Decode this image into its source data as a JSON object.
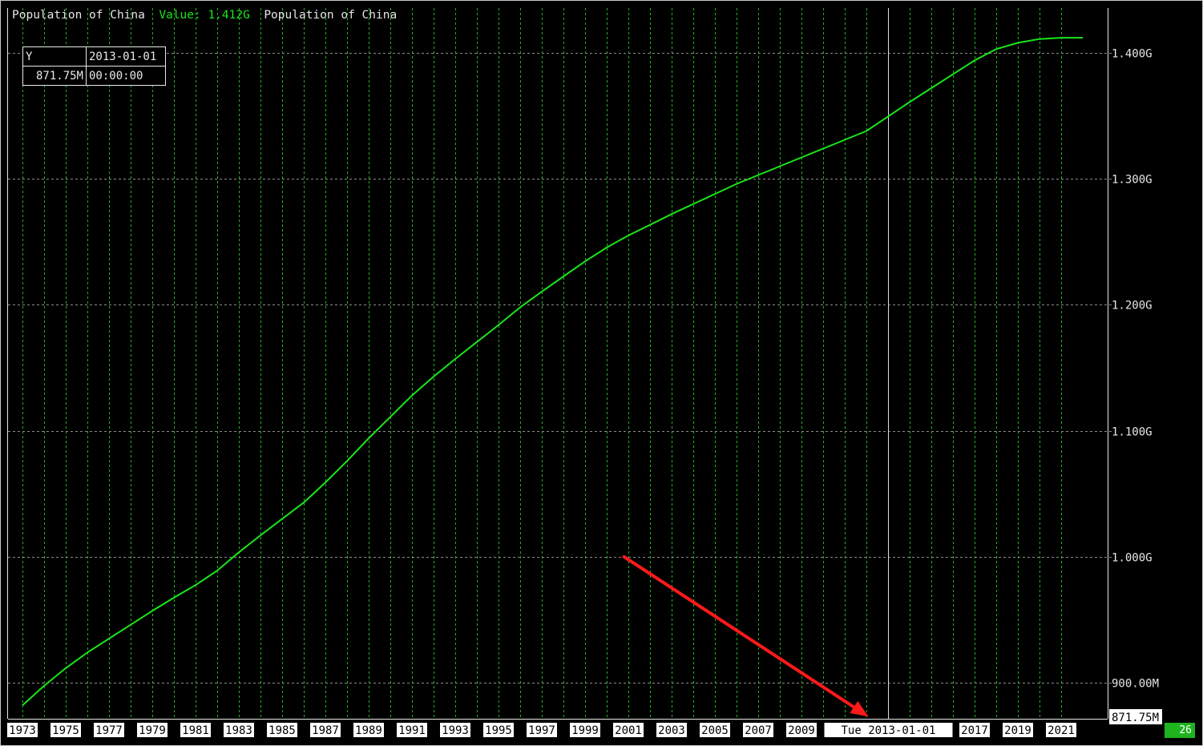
{
  "header": {
    "series_title": "Population of China",
    "value_text": "Value: 1.412G",
    "series_title_2": "Population of China"
  },
  "cursor_box": {
    "col1_header": "Y",
    "col2_header": "2013-01-01",
    "value": "871.75M",
    "time": "00:00:00"
  },
  "cursor": {
    "date_label": "Tue 2013-01-01",
    "year": 2013,
    "y_readout": "871.75M"
  },
  "status": {
    "badge": "26"
  },
  "annotation": {
    "arrow_color": "#ff1a1a",
    "arrow_from": {
      "year": 2000.8,
      "value": 1000000000
    },
    "arrow_to": {
      "year": 2012.1,
      "value": 871750000
    }
  },
  "colors": {
    "background": "#000000",
    "line": "#19e619",
    "grid_vertical": "#1fb31f",
    "grid_horizontal": "#8c8c8c",
    "cursor_line": "#e0e0e0",
    "badge": "#1fb31f"
  },
  "chart_data": {
    "type": "line",
    "title": "Population of China",
    "xlabel": "",
    "ylabel": "",
    "xlim": [
      1972,
      2023
    ],
    "ylim": [
      871750000,
      1435000000
    ],
    "grid": true,
    "y_ticks": [
      {
        "value": 900000000,
        "label": "900.00M"
      },
      {
        "value": 1000000000,
        "label": "1.000G"
      },
      {
        "value": 1100000000,
        "label": "1.100G"
      },
      {
        "value": 1200000000,
        "label": "1.200G"
      },
      {
        "value": 1300000000,
        "label": "1.300G"
      },
      {
        "value": 1400000000,
        "label": "1.400G"
      }
    ],
    "x_tick_labels": [
      "1973",
      "1975",
      "1977",
      "1979",
      "1981",
      "1983",
      "1985",
      "1987",
      "1989",
      "1991",
      "1993",
      "1995",
      "1997",
      "1999",
      "2001",
      "2003",
      "2005",
      "2007",
      "2009",
      "2017",
      "2019",
      "2021"
    ],
    "series": [
      {
        "x": [
          1973,
          1974,
          1975,
          1976,
          1977,
          1978,
          1979,
          1980,
          1981,
          1982,
          1983,
          1984,
          1985,
          1986,
          1987,
          1988,
          1989,
          1990,
          1991,
          1992,
          1993,
          1994,
          1995,
          1996,
          1997,
          1998,
          1999,
          2000,
          2001,
          2002,
          2003,
          2004,
          2005,
          2006,
          2007,
          2008,
          2009,
          2010,
          2011,
          2012,
          2013,
          2014,
          2015,
          2016,
          2017,
          2018,
          2019,
          2020,
          2021,
          2022
        ],
        "values": [
          882000000,
          897500000,
          911500000,
          924000000,
          935000000,
          946000000,
          957000000,
          967500000,
          977500000,
          989000000,
          1003500000,
          1017000000,
          1030000000,
          1043000000,
          1059000000,
          1076000000,
          1094000000,
          1111000000,
          1128000000,
          1143000000,
          1157000000,
          1170500000,
          1184000000,
          1198000000,
          1210500000,
          1222500000,
          1234500000,
          1245500000,
          1255000000,
          1263500000,
          1272000000,
          1280000000,
          1288000000,
          1296000000,
          1303000000,
          1310000000,
          1317000000,
          1324000000,
          1331000000,
          1338000000,
          1349500000,
          1361000000,
          1372000000,
          1383000000,
          1394000000,
          1403000000,
          1408000000,
          1411000000,
          1412000000,
          1412000000
        ]
      }
    ]
  }
}
